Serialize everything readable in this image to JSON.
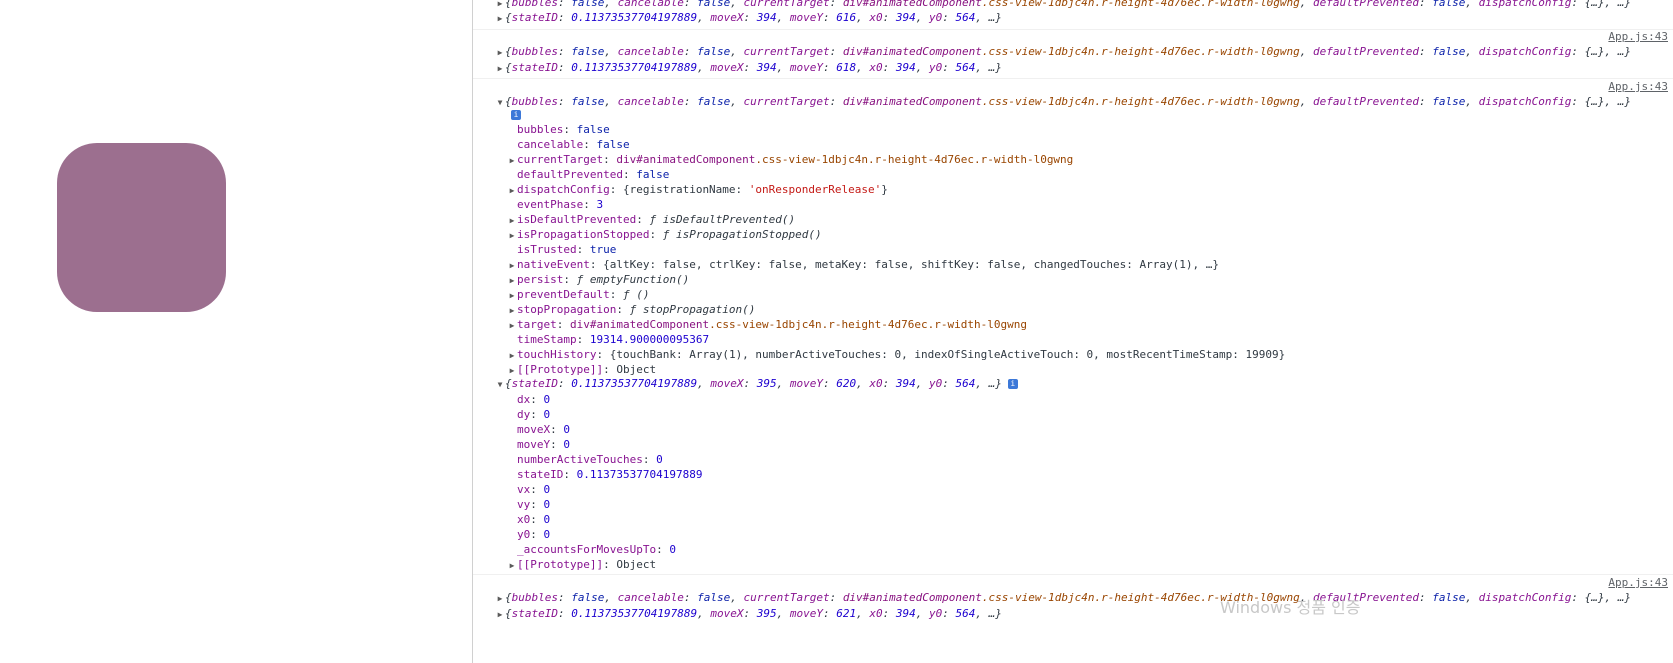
{
  "app": {
    "box_color": "#9c6f8f"
  },
  "console": {
    "source_link": "App.js:43",
    "event_summary": {
      "k1": "bubbles",
      "v1": "false",
      "k2": "cancelable",
      "v2": "false",
      "k3": "currentTarget",
      "v3": "div#animatedComponent",
      "v3b": ".css-view-1dbjc4n.r-height-4d76ec.r-width-l0gwng",
      "k4": "defaultPrevented",
      "v4": "false",
      "k5": "dispatchConfig",
      "v5": "{…}",
      "tail": ", …}"
    },
    "gesture_summaries": [
      {
        "stateID": "0.11373537704197889",
        "moveX": "394",
        "moveY": "616",
        "x0": "394",
        "y0": "564"
      },
      {
        "stateID": "0.11373537704197889",
        "moveX": "394",
        "moveY": "618",
        "x0": "394",
        "y0": "564"
      },
      {
        "stateID": "0.11373537704197889",
        "moveX": "395",
        "moveY": "620",
        "x0": "394",
        "y0": "564"
      },
      {
        "stateID": "0.11373537704197889",
        "moveX": "395",
        "moveY": "621",
        "x0": "394",
        "y0": "564"
      }
    ],
    "event_props": [
      {
        "key": "bubbles",
        "value": "false",
        "type": "bool",
        "expandable": false
      },
      {
        "key": "cancelable",
        "value": "false",
        "type": "bool",
        "expandable": false
      },
      {
        "key": "currentTarget",
        "value": "div#animatedComponent",
        "value2": ".css-view-1dbjc4n.r-height-4d76ec.r-width-l0gwng",
        "type": "node",
        "expandable": true
      },
      {
        "key": "defaultPrevented",
        "value": "false",
        "type": "bool",
        "expandable": false
      },
      {
        "key": "dispatchConfig",
        "value": "{registrationName: ",
        "value2": "'onResponderRelease'",
        "value3": "}",
        "type": "obj",
        "expandable": true
      },
      {
        "key": "eventPhase",
        "value": "3",
        "type": "num",
        "expandable": false
      },
      {
        "key": "isDefaultPrevented",
        "value": "ƒ isDefaultPrevented()",
        "type": "fn",
        "expandable": true
      },
      {
        "key": "isPropagationStopped",
        "value": "ƒ isPropagationStopped()",
        "type": "fn",
        "expandable": true
      },
      {
        "key": "isTrusted",
        "value": "true",
        "type": "bool",
        "expandable": false
      },
      {
        "key": "nativeEvent",
        "value": "{altKey: false, ctrlKey: false, metaKey: false, shiftKey: false, changedTouches: Array(1), …}",
        "type": "plain",
        "expandable": true
      },
      {
        "key": "persist",
        "value": "ƒ emptyFunction()",
        "type": "fn",
        "expandable": true
      },
      {
        "key": "preventDefault",
        "value": "ƒ ()",
        "type": "fn",
        "expandable": true
      },
      {
        "key": "stopPropagation",
        "value": "ƒ stopPropagation()",
        "type": "fn",
        "expandable": true
      },
      {
        "key": "target",
        "value": "div#animatedComponent",
        "value2": ".css-view-1dbjc4n.r-height-4d76ec.r-width-l0gwng",
        "type": "node",
        "expandable": true
      },
      {
        "key": "timeStamp",
        "value": "19314.900000095367",
        "type": "num",
        "expandable": false
      },
      {
        "key": "touchHistory",
        "value": "{touchBank: Array(1), numberActiveTouches: 0, indexOfSingleActiveTouch: 0, mostRecentTimeStamp: 19909}",
        "type": "plain",
        "expandable": true
      },
      {
        "key": "[[Prototype]]",
        "value": "Object",
        "type": "plain",
        "expandable": true
      }
    ],
    "gesture_props": [
      {
        "key": "dx",
        "value": "0"
      },
      {
        "key": "dy",
        "value": "0"
      },
      {
        "key": "moveX",
        "value": "0"
      },
      {
        "key": "moveY",
        "value": "0"
      },
      {
        "key": "numberActiveTouches",
        "value": "0"
      },
      {
        "key": "stateID",
        "value": "0.11373537704197889"
      },
      {
        "key": "vx",
        "value": "0"
      },
      {
        "key": "vy",
        "value": "0"
      },
      {
        "key": "x0",
        "value": "0"
      },
      {
        "key": "y0",
        "value": "0"
      },
      {
        "key": "_accountsForMovesUpTo",
        "value": "0"
      },
      {
        "key": "[[Prototype]]",
        "value": "Object"
      }
    ],
    "info_badge": "i"
  },
  "watermark": "Windows 정품 인증"
}
